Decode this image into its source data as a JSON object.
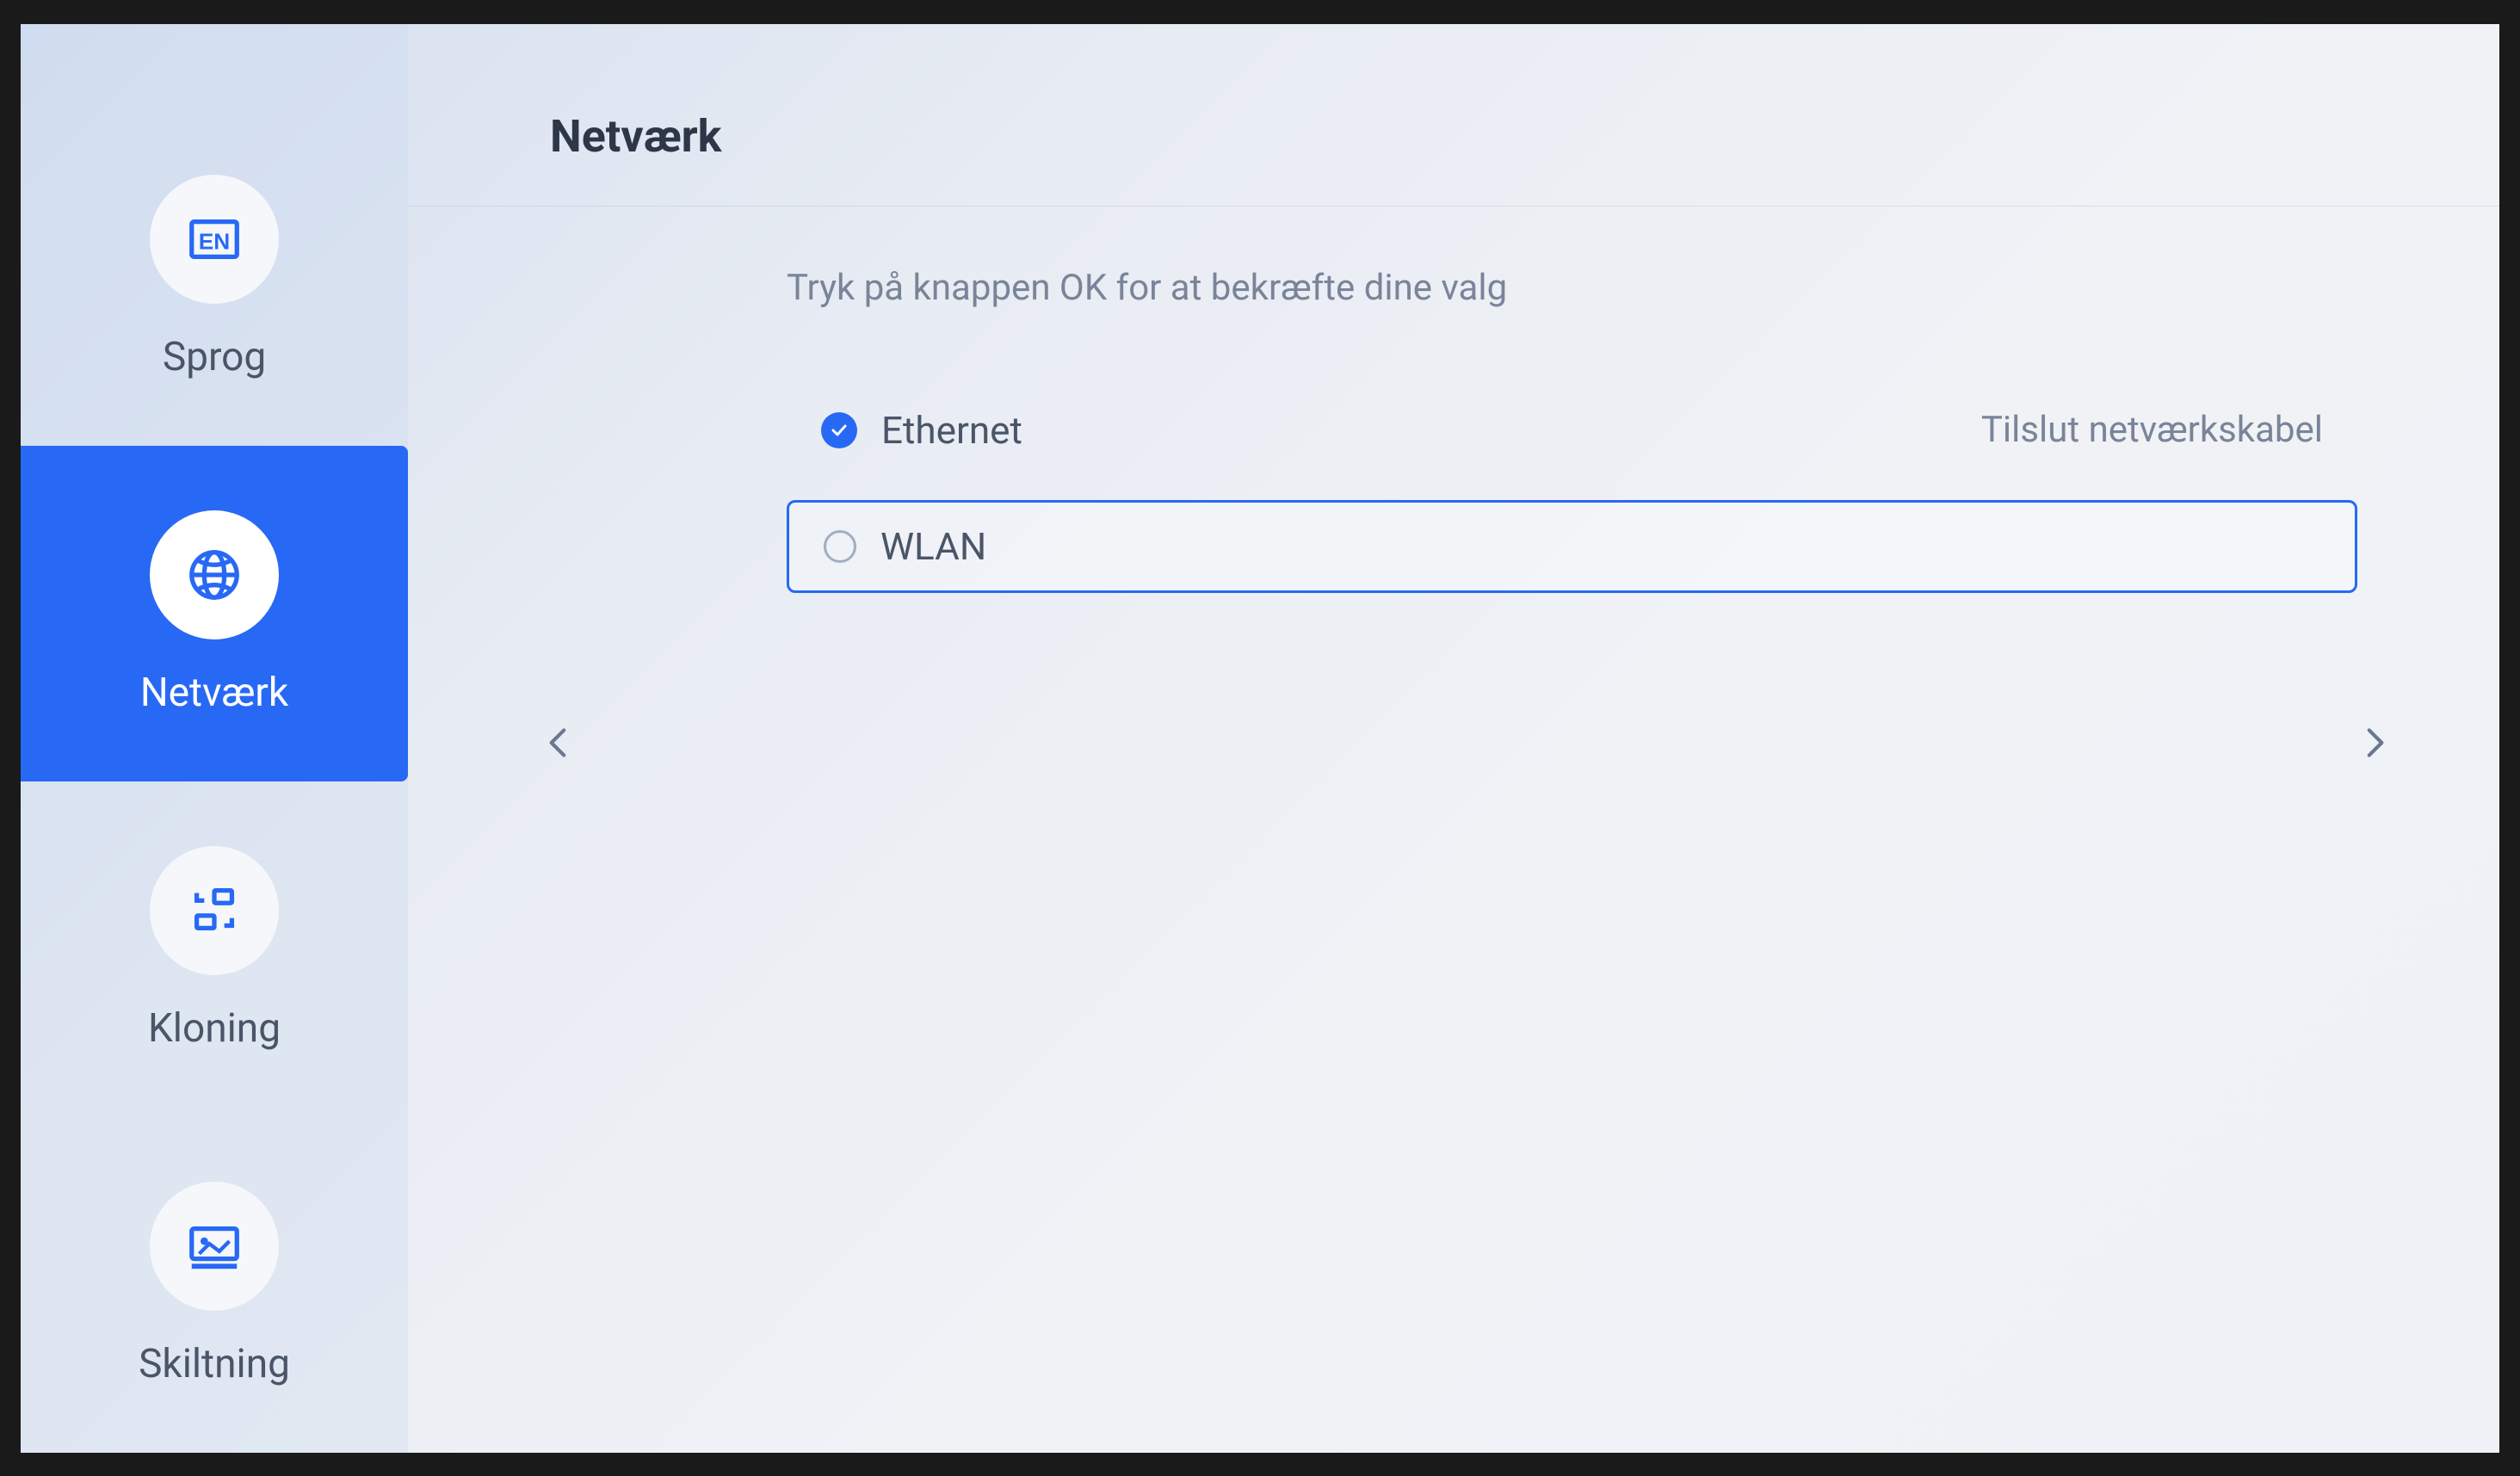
{
  "colors": {
    "accent": "#2769f5",
    "text_primary": "#2d3748",
    "text_secondary": "#4a5568",
    "text_muted": "#7a8499"
  },
  "sidebar": {
    "items": [
      {
        "id": "language",
        "label": "Sprog",
        "icon": "language-icon",
        "active": false
      },
      {
        "id": "network",
        "label": "Netværk",
        "icon": "network-icon",
        "active": true
      },
      {
        "id": "cloning",
        "label": "Kloning",
        "icon": "cloning-icon",
        "active": false
      },
      {
        "id": "signage",
        "label": "Skiltning",
        "icon": "signage-icon",
        "active": false
      }
    ]
  },
  "main": {
    "title": "Netværk",
    "instruction": "Tryk på knappen OK for at bekræfte dine valg",
    "options": [
      {
        "id": "ethernet",
        "label": "Ethernet",
        "selected": true,
        "highlighted": false,
        "status": "Tilslut netværkskabel"
      },
      {
        "id": "wlan",
        "label": "WLAN",
        "selected": false,
        "highlighted": true,
        "status": ""
      }
    ]
  }
}
